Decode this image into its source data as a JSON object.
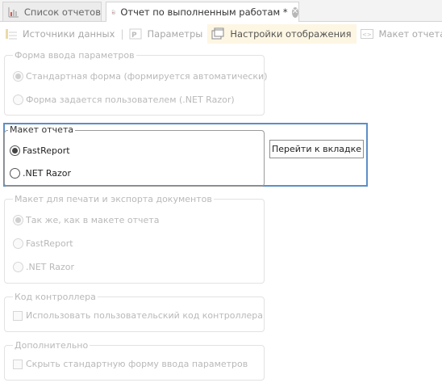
{
  "tabs": [
    {
      "label": "Список отчетов",
      "icon": "chart-icon",
      "active": false
    },
    {
      "label": "Отчет по выполненным работам *",
      "icon": "document-icon",
      "active": true
    }
  ],
  "toolbar": {
    "items": [
      {
        "label": "Источники данных",
        "icon": "database-icon",
        "active": false
      },
      {
        "label": "Параметры",
        "icon": "parameters-icon",
        "active": false
      },
      {
        "label": "Настройки отображения",
        "icon": "window-icon",
        "active": true
      },
      {
        "label": "Макет отчета",
        "icon": "code-icon",
        "active": false
      }
    ]
  },
  "input_form": {
    "title": "Форма ввода параметров",
    "options": [
      {
        "label": "Стандартная форма (формируется автоматически)",
        "checked": true
      },
      {
        "label": "Форма задается пользователем (.NET Razor)",
        "checked": false
      }
    ]
  },
  "report_layout": {
    "title": "Макет отчета",
    "options": [
      {
        "label": "FastReport",
        "checked": true
      },
      {
        "label": ".NET Razor",
        "checked": false
      }
    ],
    "goto_button": "Перейти к вкладке"
  },
  "print_layout": {
    "title": "Макет для печати и экспорта документов",
    "options": [
      {
        "label": "Так же, как в макете отчета",
        "checked": true
      },
      {
        "label": "FastReport",
        "checked": false
      },
      {
        "label": ".NET Razor",
        "checked": false
      }
    ]
  },
  "controller_code": {
    "title": "Код контроллера",
    "checkbox": {
      "label": "Использовать пользовательский код контроллера",
      "checked": false
    }
  },
  "additional": {
    "title": "Дополнительно",
    "checkbox": {
      "label": "Скрыть стандартную форму ввода параметров",
      "checked": false
    }
  },
  "colors": {
    "highlight_border": "#5b8fc7",
    "active_toolbar_bg": "#fdf6e3",
    "disabled_text": "#b9b9b9"
  }
}
